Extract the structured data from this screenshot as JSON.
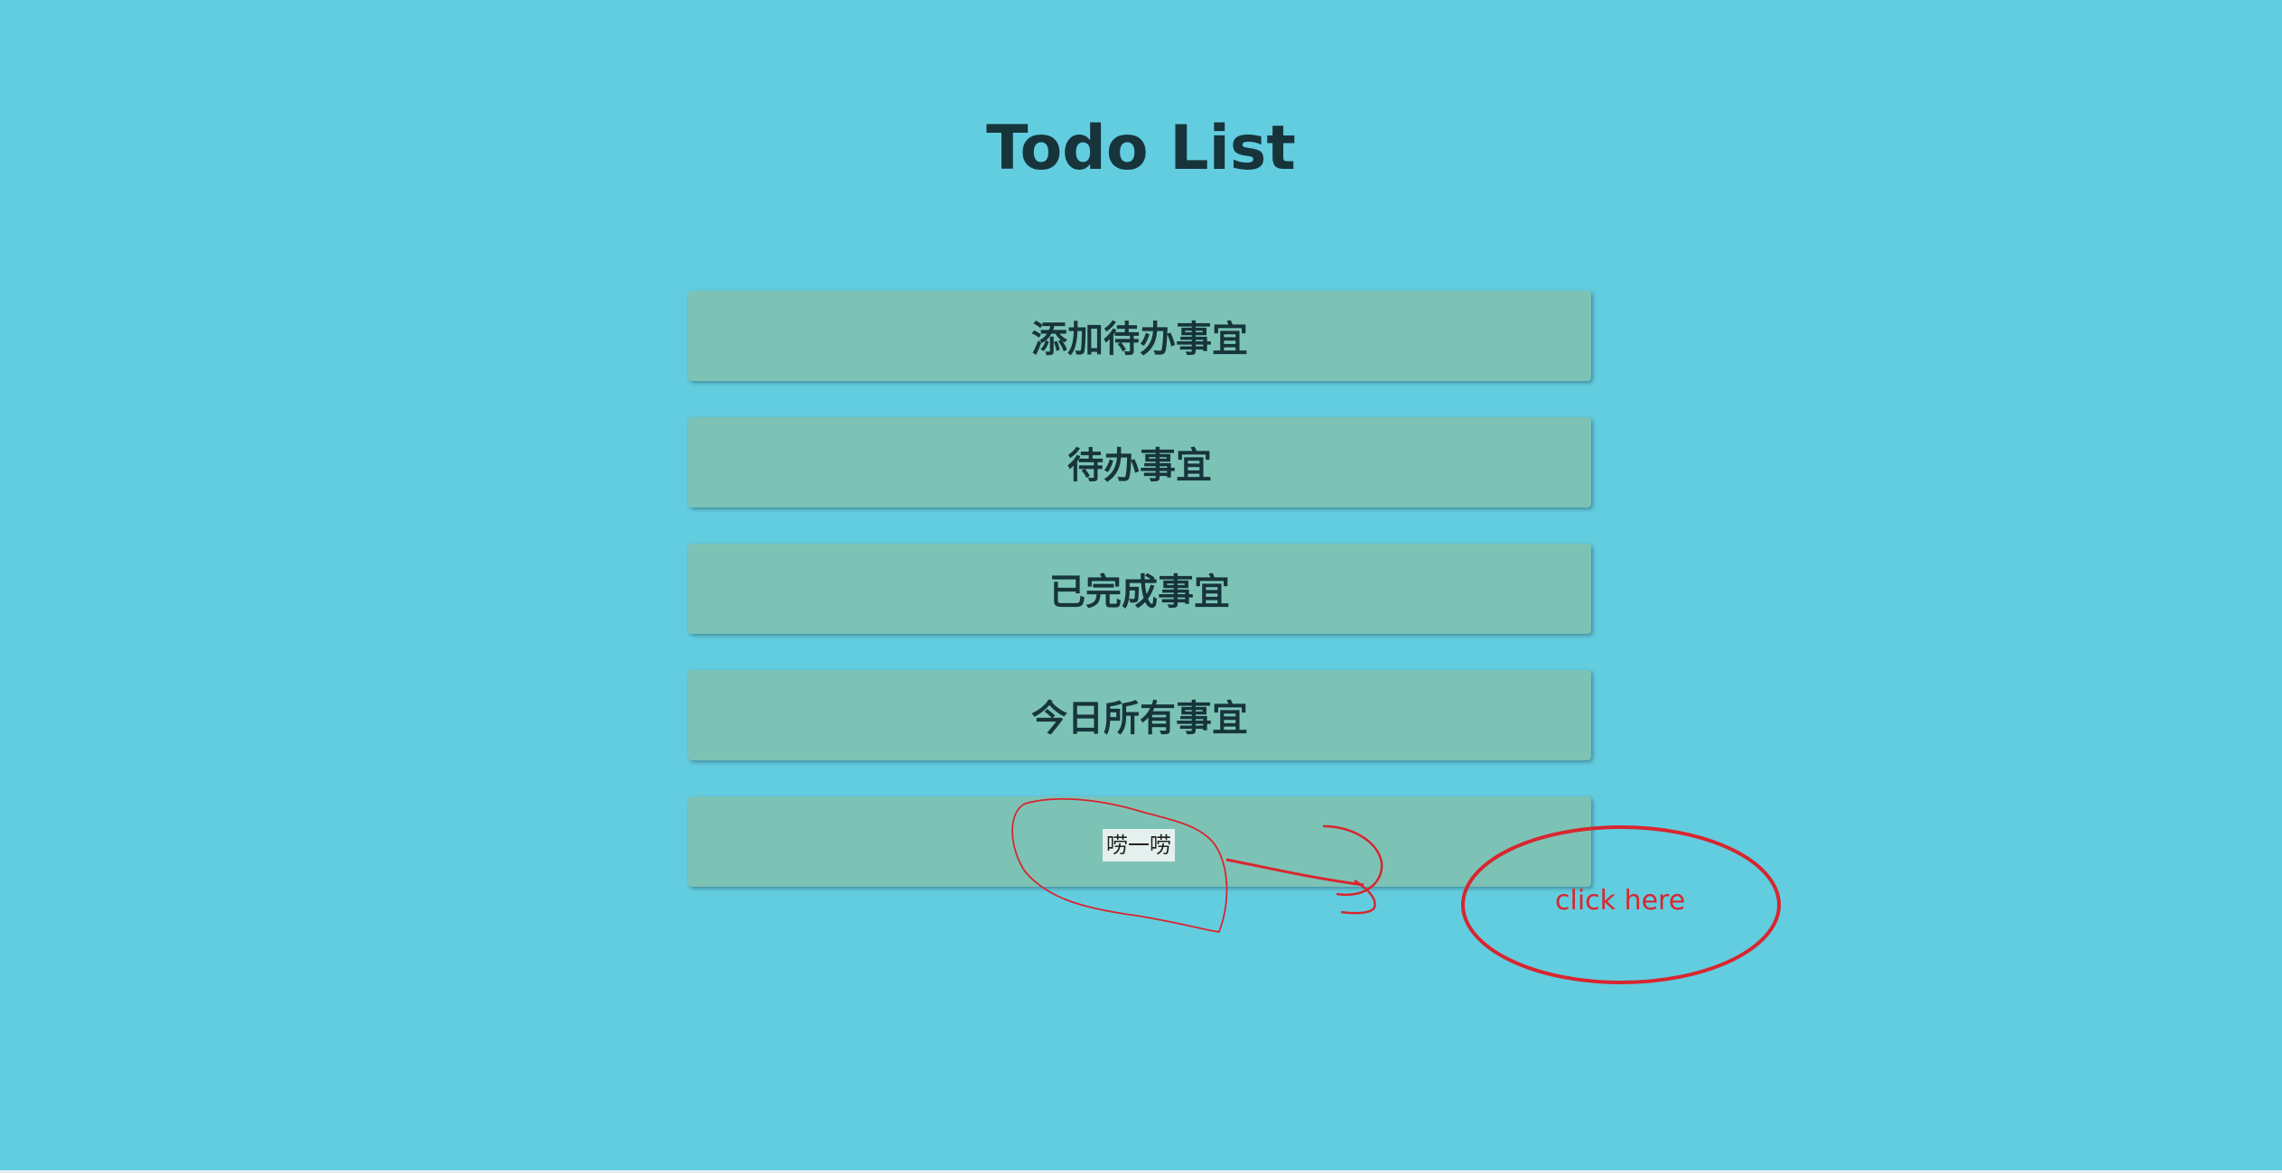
{
  "page": {
    "title": "Todo List",
    "background": "#63cde0"
  },
  "menu": {
    "button_color": "#7cc3b6",
    "text_color": "#17343b",
    "items": [
      {
        "label": "添加待办事宜"
      },
      {
        "label": "待办事宜"
      },
      {
        "label": "已完成事宜"
      },
      {
        "label": "今日所有事宜"
      },
      {
        "label": "唠一唠"
      }
    ]
  },
  "annotation": {
    "text": "click here",
    "color": "#d8262f"
  }
}
